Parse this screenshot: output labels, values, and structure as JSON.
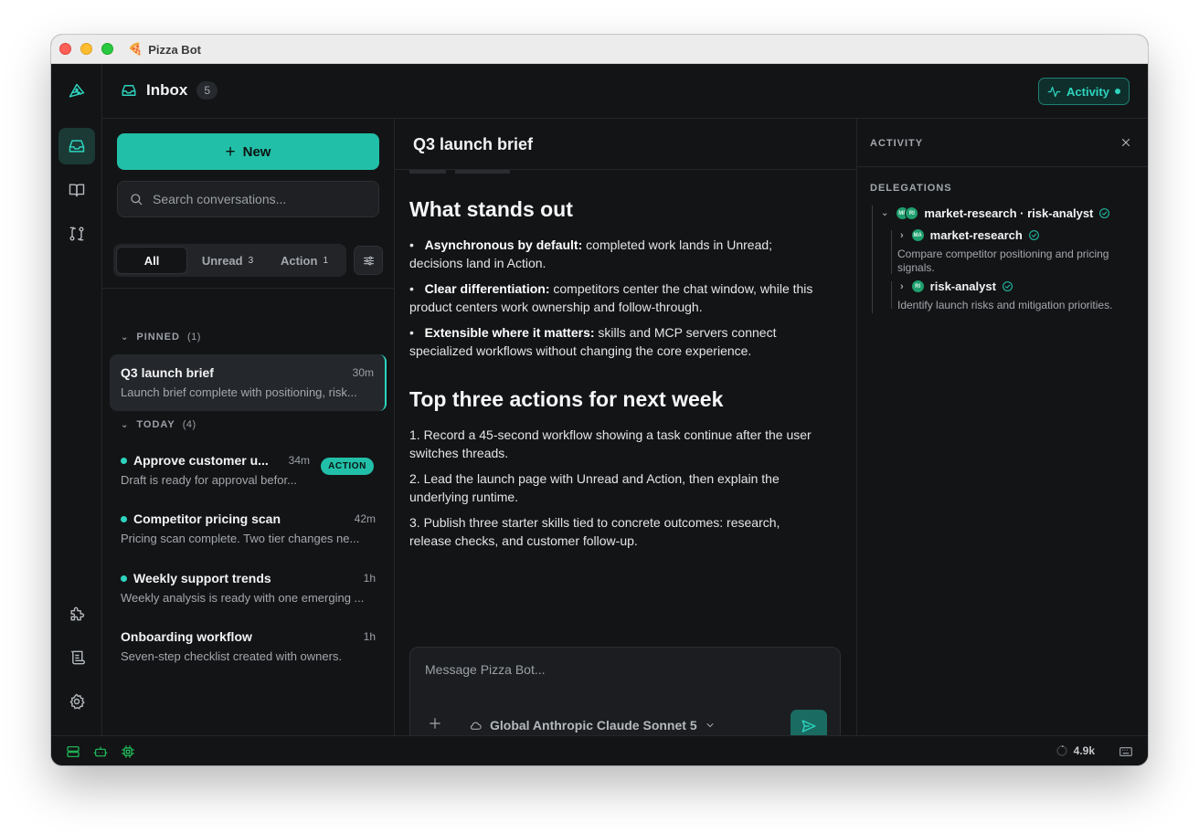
{
  "window": {
    "app_emoji": "🍕",
    "app_title": "Pizza Bot"
  },
  "rail": {
    "logo_icon": "pizza-logo-icon",
    "items": [
      {
        "icon": "inbox-icon",
        "active": true
      },
      {
        "icon": "book-icon",
        "active": false
      },
      {
        "icon": "workflow-icon",
        "active": false
      },
      {
        "icon": "puzzle-icon",
        "active": false
      },
      {
        "icon": "scroll-icon",
        "active": false
      },
      {
        "icon": "gear-icon",
        "active": false
      }
    ]
  },
  "topbar": {
    "title": "Inbox",
    "count": "5",
    "activity_label": "Activity"
  },
  "list": {
    "new_label": "New",
    "search_placeholder": "Search conversations...",
    "filters": [
      {
        "label": "All",
        "count": ""
      },
      {
        "label": "Unread",
        "count": "3"
      },
      {
        "label": "Action",
        "count": "1"
      }
    ],
    "pinned": {
      "label": "PINNED",
      "count": "(1)",
      "items": [
        {
          "title": "Q3 launch brief",
          "time": "30m",
          "preview": "Launch brief complete with positioning, risk...",
          "unread": false
        }
      ]
    },
    "today": {
      "label": "TODAY",
      "count": "(4)",
      "items": [
        {
          "title": "Approve customer u...",
          "time": "34m",
          "preview": "Draft is ready for approval befor...",
          "unread": true,
          "badge": "ACTION"
        },
        {
          "title": "Competitor pricing scan",
          "time": "42m",
          "preview": "Pricing scan complete. Two tier changes ne...",
          "unread": true
        },
        {
          "title": "Weekly support trends",
          "time": "1h",
          "preview": "Weekly analysis is ready with one emerging ...",
          "unread": true
        },
        {
          "title": "Onboarding workflow",
          "time": "1h",
          "preview": "Seven-step checklist created with owners.",
          "unread": false
        }
      ]
    }
  },
  "main": {
    "title": "Q3 launch brief",
    "h1": "What stands out",
    "bullets": [
      {
        "bold": "Asynchronous by default:",
        "text": " completed work lands in Unread; decisions land in Action."
      },
      {
        "bold": "Clear differentiation:",
        "text": " competitors center the chat window, while this product centers work ownership and follow-through."
      },
      {
        "bold": "Extensible where it matters:",
        "text": " skills and MCP servers connect specialized workflows without changing the core experience."
      }
    ],
    "h2": "Top three actions for next week",
    "actions": [
      "1. Record a 45-second workflow showing a task continue after the user switches threads.",
      "2. Lead the launch page with Unread and Action, then explain the underlying runtime.",
      "3. Publish three starter skills tied to concrete outcomes: research, release checks, and customer follow-up."
    ],
    "composer_placeholder": "Message Pizza Bot...",
    "model_label": "Global Anthropic Claude Sonnet 5"
  },
  "activity": {
    "title": "ACTIVITY",
    "section": "DELEGATIONS",
    "root": {
      "label": "market-research · risk-analyst",
      "avatars": [
        "MR",
        "RI"
      ]
    },
    "children": [
      {
        "label": "market-research",
        "avatar": "MA",
        "desc": "Compare competitor positioning and pricing signals."
      },
      {
        "label": "risk-analyst",
        "avatar": "RI",
        "desc": "Identify launch risks and mitigation priorities."
      }
    ]
  },
  "status": {
    "tokens": "4.9k"
  },
  "colors": {
    "accent": "#22bfa8",
    "accent_text": "#2dd4bf",
    "bg": "#131416"
  }
}
